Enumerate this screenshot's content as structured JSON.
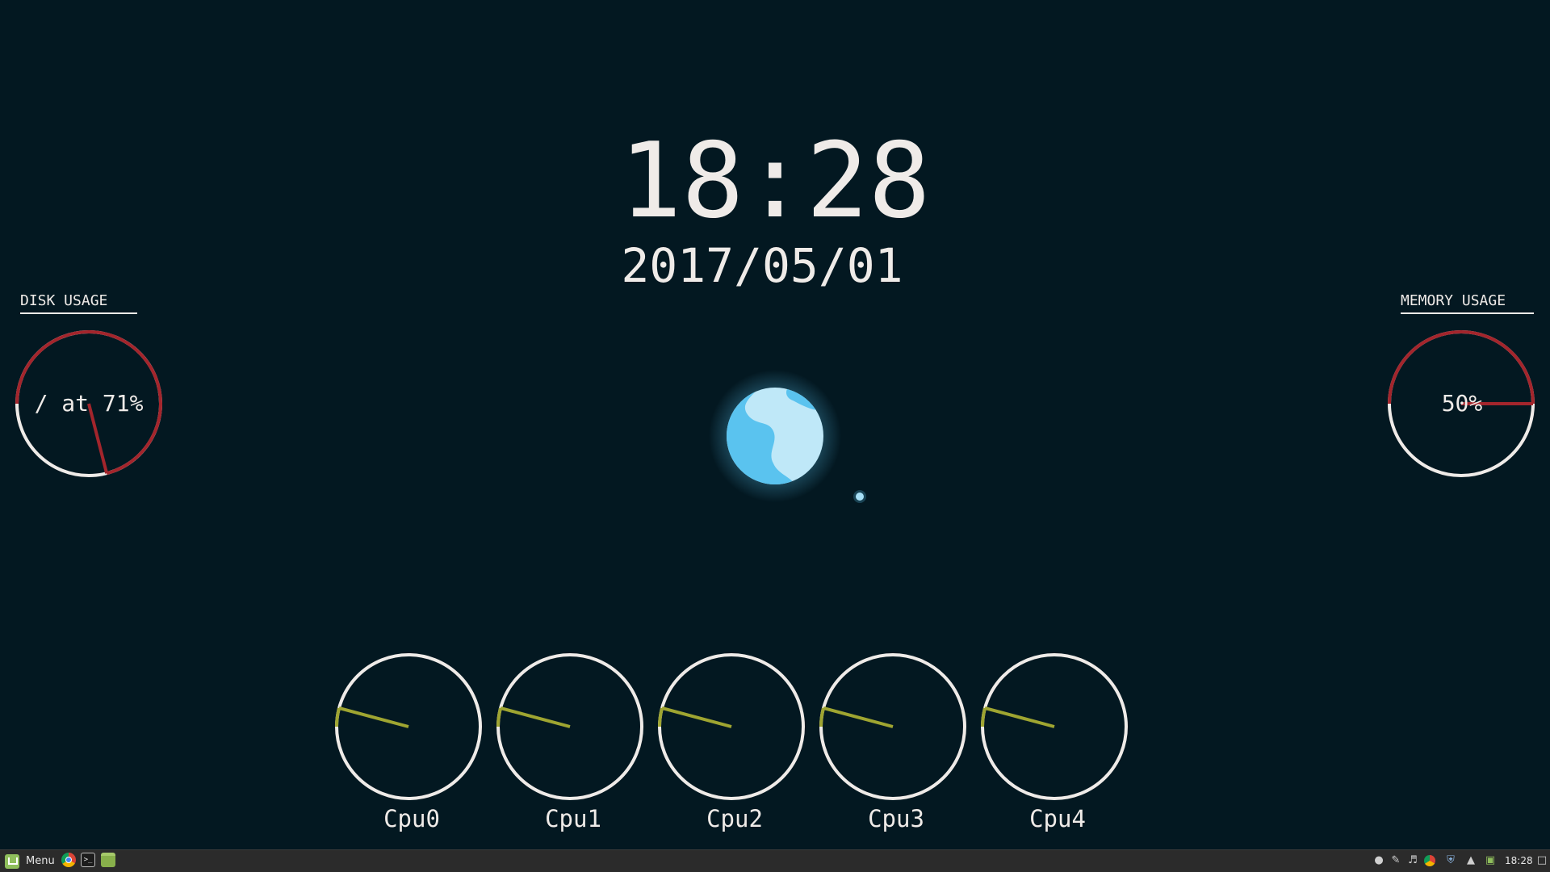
{
  "clock": {
    "time": "18:28",
    "date": "2017/05/01"
  },
  "disk": {
    "heading": "DISK USAGE",
    "label": "/ at 71%",
    "percent": 71
  },
  "memory": {
    "heading": "MEMORY USAGE",
    "label": "50%",
    "percent": 50
  },
  "cpus": [
    {
      "label": "Cpu0"
    },
    {
      "label": "Cpu1"
    },
    {
      "label": "Cpu2"
    },
    {
      "label": "Cpu3"
    },
    {
      "label": "Cpu4"
    }
  ],
  "colors": {
    "background": "#031821",
    "ring": "#efebe8",
    "usage_arc": "#a3252c",
    "cpu_needle": "#9fa531",
    "earth_ocean": "#5ac3ef",
    "earth_land": "#bfe8f8"
  },
  "taskbar": {
    "menu_label": "Menu",
    "launchers": [
      "chrome-icon",
      "terminal-icon",
      "files-icon"
    ],
    "tray_icons": [
      "user-icon",
      "pen-icon",
      "volume-icon",
      "chrome-icon",
      "shield-icon",
      "update-icon",
      "network-icon"
    ],
    "clock": "18:28"
  }
}
